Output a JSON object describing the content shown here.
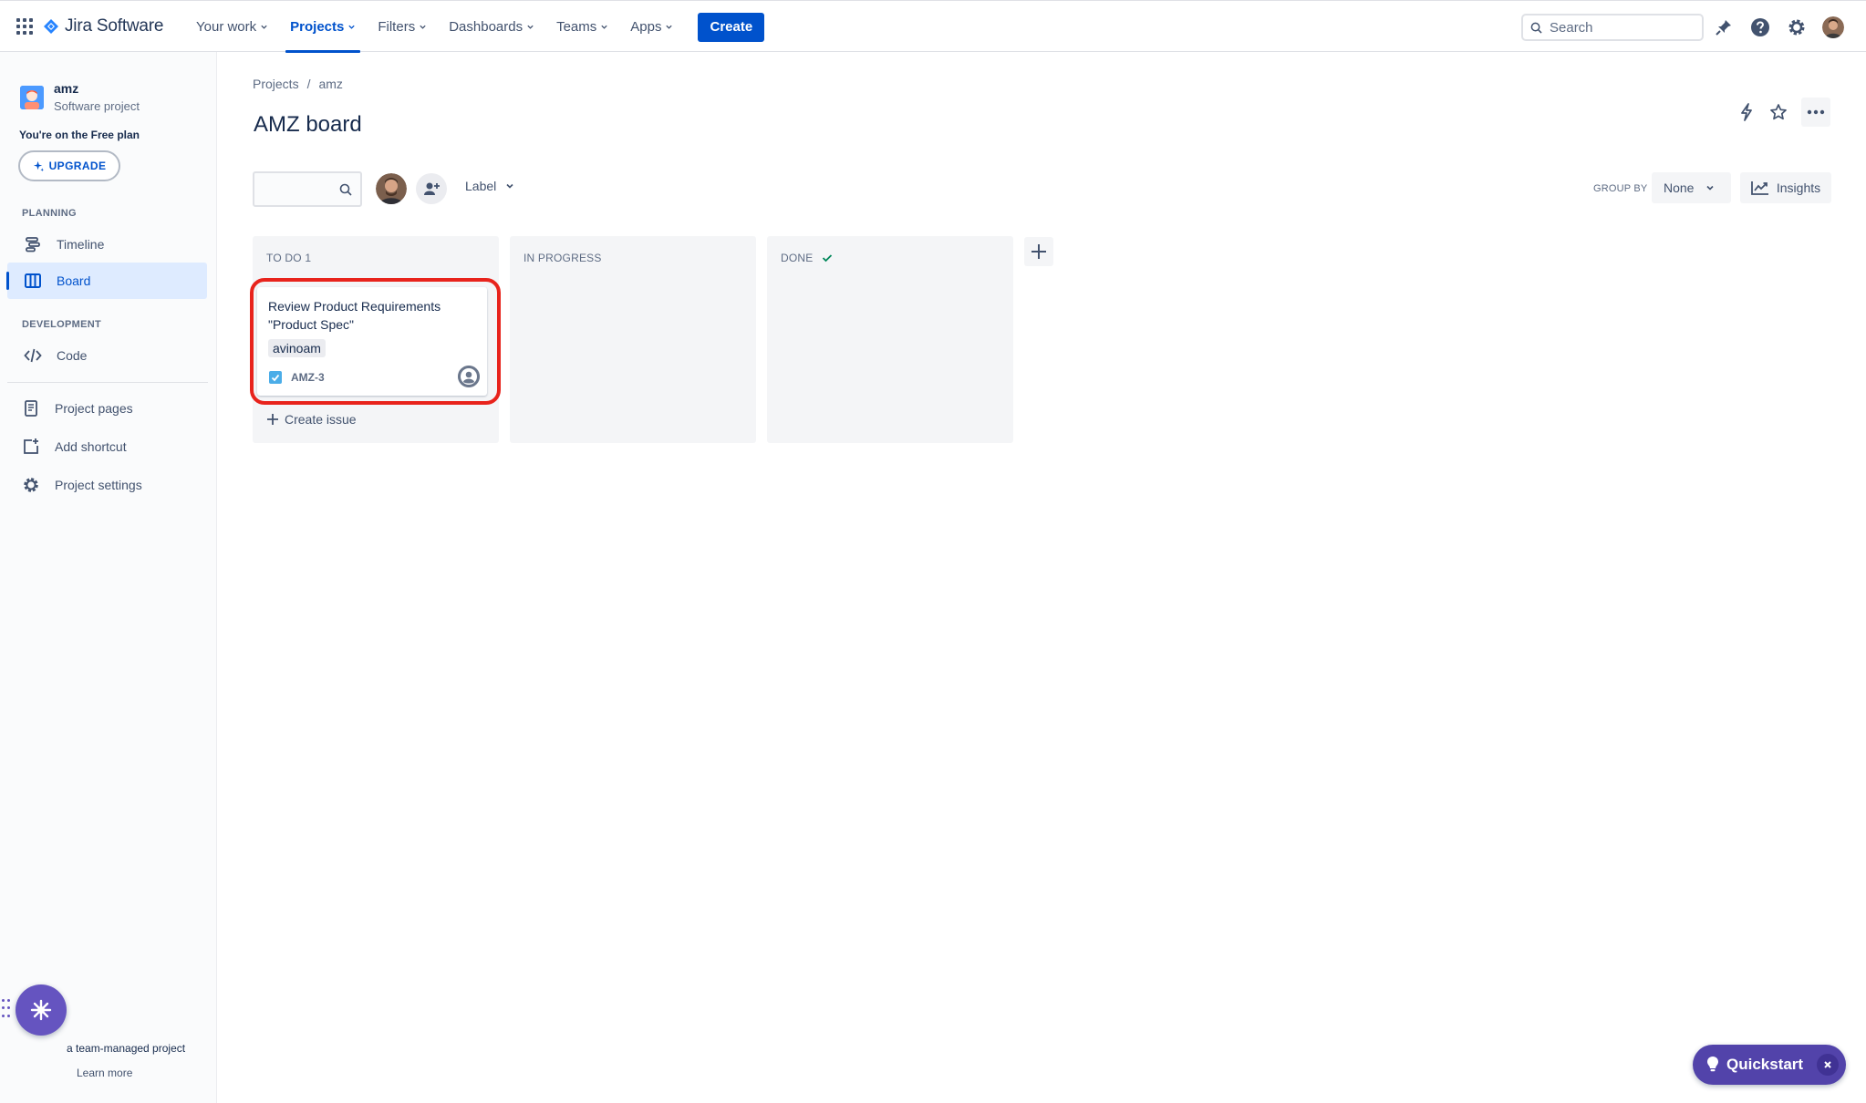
{
  "topnav": {
    "product_name": "Jira Software",
    "items": [
      {
        "label": "Your work",
        "active": false
      },
      {
        "label": "Projects",
        "active": true
      },
      {
        "label": "Filters",
        "active": false
      },
      {
        "label": "Dashboards",
        "active": false
      },
      {
        "label": "Teams",
        "active": false
      },
      {
        "label": "Apps",
        "active": false
      }
    ],
    "create_label": "Create",
    "search_placeholder": "Search",
    "icons": [
      "apps-grid-icon",
      "notifications-icon",
      "help-icon",
      "settings-icon",
      "profile-avatar"
    ]
  },
  "sidebar": {
    "project_name": "amz",
    "project_type": "Software project",
    "plan_text": "You're on the Free plan",
    "upgrade_label": "UPGRADE",
    "planning_title": "PLANNING",
    "development_title": "DEVELOPMENT",
    "items": [
      {
        "label": "Timeline",
        "icon": "timeline-icon"
      },
      {
        "label": "Board",
        "icon": "board-icon",
        "selected": true
      },
      {
        "label": "Code",
        "icon": "code-icon"
      },
      {
        "label": "Project pages",
        "icon": "page-icon"
      },
      {
        "label": "Add shortcut",
        "icon": "add-shortcut-icon"
      },
      {
        "label": "Project settings",
        "icon": "settings-icon"
      }
    ],
    "footer_text": "a team-managed project",
    "learn_more": "Learn more"
  },
  "main": {
    "breadcrumb": [
      "Projects",
      "amz"
    ],
    "breadcrumb_sep": "/",
    "title": "AMZ board",
    "label_filter": "Label",
    "group_by_label": "GROUP BY",
    "group_by_value": "None",
    "insights_label": "Insights",
    "columns": [
      {
        "title": "TO DO 1"
      },
      {
        "title": "IN PROGRESS"
      },
      {
        "title": "DONE",
        "done_check": true
      }
    ],
    "card": {
      "title": "Review Product Requirements \"Product Spec\"",
      "label": "avinoam",
      "key": "AMZ-3"
    },
    "create_issue": "Create issue"
  },
  "quickstart": {
    "label": "Quickstart"
  },
  "colors": {
    "primary": "#0052cc",
    "highlight": "#e8231c",
    "quickstart": "#5243aa",
    "column_bg": "#f4f5f7"
  }
}
